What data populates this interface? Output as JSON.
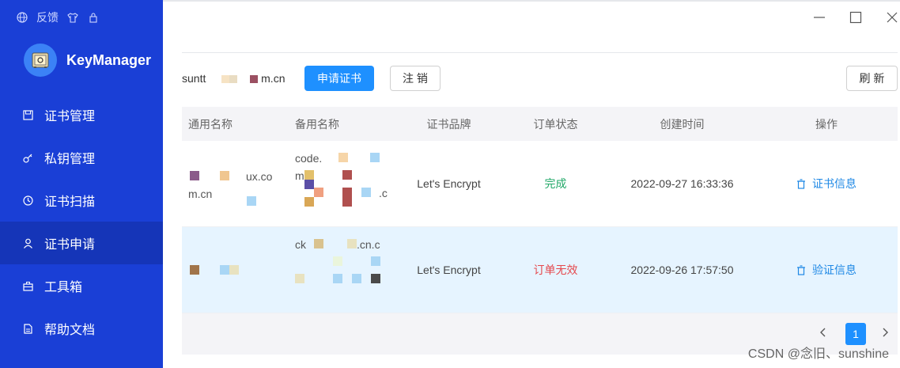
{
  "sidebar": {
    "top_feedback": "反馈",
    "app_name": "KeyManager",
    "items": [
      {
        "label": "证书管理"
      },
      {
        "label": "私钥管理"
      },
      {
        "label": "证书扫描"
      },
      {
        "label": "证书申请"
      },
      {
        "label": "工具箱"
      },
      {
        "label": "帮助文档"
      }
    ]
  },
  "toolbar": {
    "email_prefix": "suntt",
    "email_suffix": "m.cn",
    "apply_label": "申请证书",
    "logout_label": "注 销",
    "refresh_label": "刷 新"
  },
  "table": {
    "headers": [
      "通用名称",
      "备用名称",
      "证书品牌",
      "订单状态",
      "创建时间",
      "操作"
    ],
    "rows": [
      {
        "common_name_visible": "ux.co",
        "common_name_visible2": "m.cn",
        "alt_line1": "code.",
        "alt_line2": "m",
        "alt_line3": ".c",
        "brand": "Let's Encrypt",
        "status": "完成",
        "created": "2022-09-27 16:33:36",
        "action": "证书信息"
      },
      {
        "common_name_visible": "",
        "alt_line1": "ck",
        "alt_line1b": ".cn.c",
        "brand": "Let's Encrypt",
        "status": "订单无效",
        "created": "2022-09-26 17:57:50",
        "action": "验证信息"
      }
    ]
  },
  "pagination": {
    "current": "1"
  },
  "watermark": "CSDN @念旧、sunshine",
  "colors": {
    "sidebar": "#1a3fd6",
    "primary": "#1e90ff",
    "ok": "#22a868",
    "bad": "#e5484d"
  }
}
